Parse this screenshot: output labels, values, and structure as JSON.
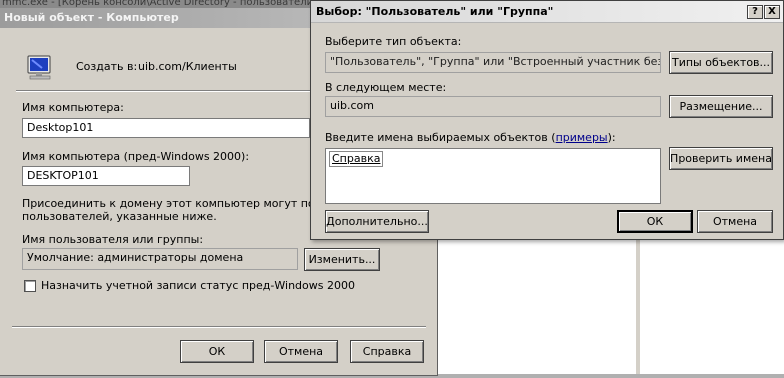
{
  "background": {
    "window_title": "mmc.exe - [Корень консоли\\Active Directory - пользователи и компьютеры]"
  },
  "new_object_dialog": {
    "title": "Новый объект - Компьютер",
    "create_in_label": "Создать в:",
    "create_in_path": "uib.com/Клиенты",
    "computer_name_label": "Имя компьютера:",
    "computer_name_value": "Desktop101",
    "pre2000_label": "Имя компьютера (пред-Windows 2000):",
    "pre2000_value": "DESKTOP101",
    "join_text_line1": "Присоединить к домену этот компьютер могут пользова",
    "join_text_line2": "пользователей, указанные ниже.",
    "user_or_group_label": "Имя пользователя или группы:",
    "user_or_group_value": "Умолчание: администраторы домена",
    "change_button": "Изменить...",
    "assign_checkbox_label": "Назначить учетной записи статус пред-Windows 2000",
    "assign_checked": false,
    "ok_button": "ОК",
    "cancel_button": "Отмена",
    "help_button": "Справка"
  },
  "select_dialog": {
    "title": "Выбор: \"Пользователь\" или \"Группа\"",
    "help_glyph": "?",
    "close_glyph": "X",
    "object_type_label": "Выберите тип объекта:",
    "object_type_value": "\"Пользователь\", \"Группа\" или \"Встроенный участник безопасност",
    "object_types_button": "Типы объектов...",
    "location_label": "В следующем месте:",
    "location_value": "uib.com",
    "locations_button": "Размещение...",
    "enter_names_label": "Введите имена выбираемых объектов (",
    "examples_link": "примеры",
    "enter_names_suffix": "):",
    "entered_name": "Справка",
    "check_names_button": "Проверить имена",
    "advanced_button": "Дополнительно...",
    "ok_button": "ОК",
    "cancel_button": "Отмена"
  },
  "icons": {
    "computer": "computer-monitor-icon",
    "checkbox": "checkbox-icon"
  }
}
